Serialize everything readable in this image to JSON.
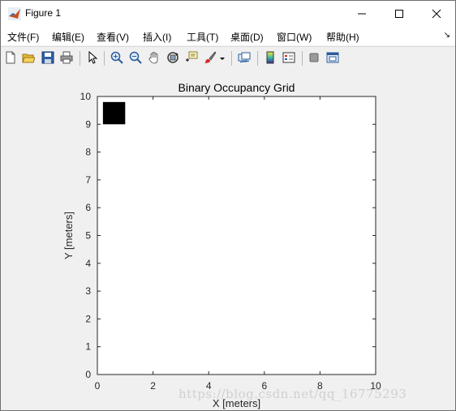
{
  "window": {
    "title": "Figure 1"
  },
  "menu": [
    "文件(F)",
    "编辑(E)",
    "查看(V)",
    "插入(I)",
    "工具(T)",
    "桌面(D)",
    "窗口(W)",
    "帮助(H)"
  ],
  "toolbar": [
    "new-figure",
    "open-file",
    "save",
    "print",
    "select-pointer",
    "zoom-in",
    "zoom-out",
    "pan",
    "rotate-3d",
    "data-cursor",
    "brush",
    "link-plot",
    "insert-colorbar",
    "insert-legend",
    "hide-plot-tools",
    "show-plot-tools"
  ],
  "chart_data": {
    "type": "heatmap",
    "title": "Binary Occupancy Grid",
    "xlabel": "X [meters]",
    "ylabel": "Y [meters]",
    "xlim": [
      0,
      10
    ],
    "ylim": [
      0,
      10
    ],
    "xticks": [
      "0",
      "2",
      "4",
      "6",
      "8",
      "10"
    ],
    "yticks": [
      "0",
      "1",
      "2",
      "3",
      "4",
      "5",
      "6",
      "7",
      "8",
      "9",
      "10"
    ],
    "occupied_cells": [
      {
        "x0": 0.2,
        "x1": 1.0,
        "y0": 9.0,
        "y1": 9.8
      }
    ],
    "occupied_color": "#000000",
    "free_color": "#ffffff"
  },
  "watermark": "https://blog.csdn.net/qq_16775293"
}
